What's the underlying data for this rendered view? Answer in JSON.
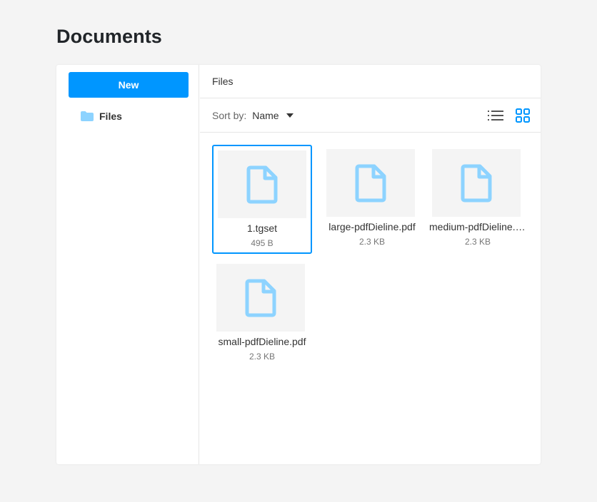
{
  "page": {
    "title": "Documents"
  },
  "sidebar": {
    "new_label": "New",
    "tree": [
      {
        "label": "Files",
        "icon": "folder-icon"
      }
    ]
  },
  "main": {
    "header": "Files",
    "toolbar": {
      "sort_label": "Sort by:",
      "sort_value": "Name",
      "views": [
        "list-view-icon",
        "grid-view-icon"
      ],
      "active_view": "grid"
    },
    "files": [
      {
        "name": "1.tgset",
        "size": "495 B",
        "selected": true
      },
      {
        "name": "large-pdfDieline.pdf",
        "size": "2.3 KB",
        "selected": false
      },
      {
        "name": "medium-pdfDieline.pdf",
        "size": "2.3 KB",
        "selected": false
      },
      {
        "name": "small-pdfDieline.pdf",
        "size": "2.3 KB",
        "selected": false
      }
    ]
  },
  "colors": {
    "accent": "#0096ff",
    "icon_light": "#8dd3ff",
    "background": "#f4f4f4"
  }
}
